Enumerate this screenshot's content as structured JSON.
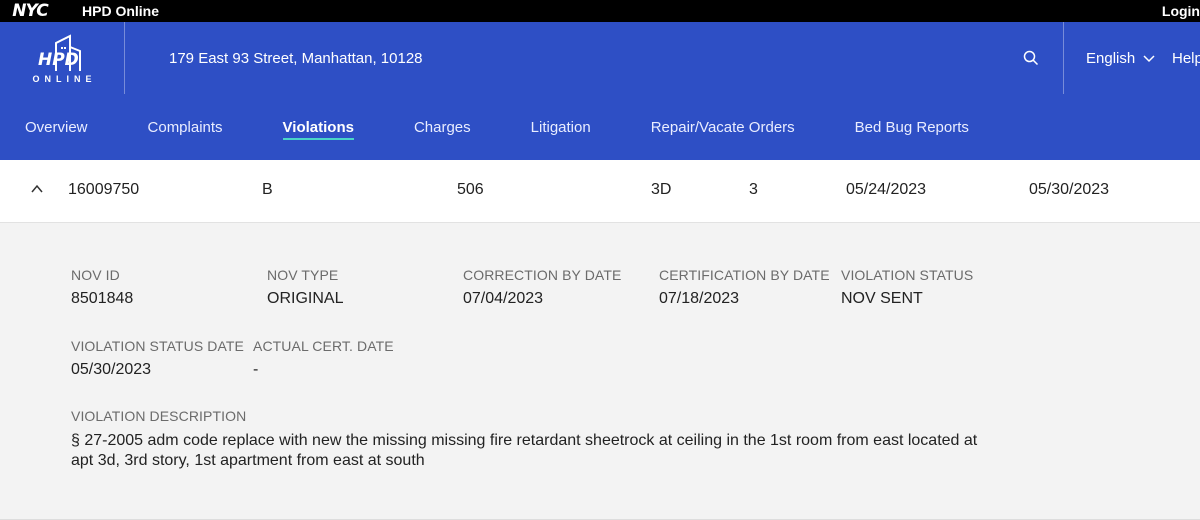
{
  "topbar": {
    "nyc": "NYC",
    "title": "HPD Online",
    "login": "Login"
  },
  "header": {
    "brand_word": "ONLINE",
    "address": "179 East 93 Street, Manhattan, 10128",
    "language": "English",
    "help": "Help"
  },
  "nav": {
    "items": [
      {
        "label": "Overview"
      },
      {
        "label": "Complaints"
      },
      {
        "label": "Violations"
      },
      {
        "label": "Charges"
      },
      {
        "label": "Litigation"
      },
      {
        "label": "Repair/Vacate Orders"
      },
      {
        "label": "Bed Bug Reports"
      }
    ],
    "active": "Violations",
    "accent": "#49d4c8"
  },
  "violation": {
    "id": "16009750",
    "class": "B",
    "col3": "506",
    "apartment": "3D",
    "story": "3",
    "date1": "05/24/2023",
    "date2": "05/30/2023"
  },
  "details": {
    "nov_id_label": "NOV ID",
    "nov_id": "8501848",
    "nov_type_label": "NOV TYPE",
    "nov_type": "ORIGINAL",
    "correction_label": "CORRECTION BY DATE",
    "correction": "07/04/2023",
    "certification_label": "CERTIFICATION BY DATE",
    "certification": "07/18/2023",
    "status_label": "VIOLATION STATUS",
    "status": "NOV SENT",
    "status_date_label": "VIOLATION STATUS DATE",
    "status_date": "05/30/2023",
    "actual_cert_label": "ACTUAL CERT. DATE",
    "actual_cert": "-",
    "description_label": "VIOLATION DESCRIPTION",
    "description": "§ 27-2005 adm code replace with new the missing missing fire retardant sheetrock at ceiling in the 1st room from east located at apt 3d, 3rd story, 1st apartment from east at south"
  },
  "colors": {
    "header_blue": "#2e4fc5",
    "topbar": "#000000",
    "panel_bg": "#f3f3f3"
  }
}
